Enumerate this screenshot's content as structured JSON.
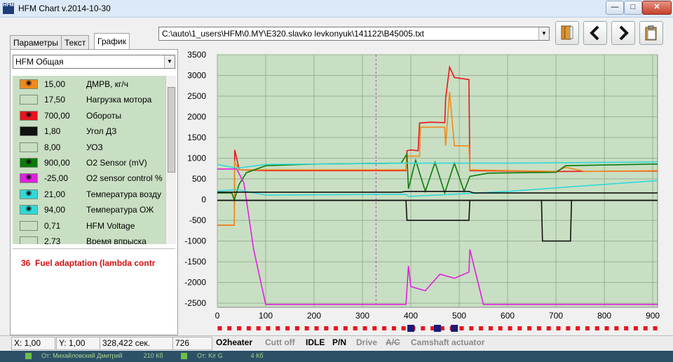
{
  "window": {
    "title": "HFM Chart  v.2014-10-30",
    "icon": "HFM"
  },
  "window_controls": {
    "minimize": "—",
    "maximize": "□",
    "close": "✕"
  },
  "tabs": [
    {
      "label": "Параметры"
    },
    {
      "label": "Текст"
    },
    {
      "label": "График"
    }
  ],
  "preset": {
    "value": "HFM Общая"
  },
  "file": {
    "path": "C:\\auto\\1_users\\HFM\\0.MY\\E320.slavko levkonyuk\\141122\\B45005.txt"
  },
  "toolbar_icons": [
    "book-icon",
    "arrow-left-icon",
    "arrow-right-icon",
    "clipboard-icon"
  ],
  "sensors": [
    {
      "value": "15,00",
      "name": "ДМРВ, кг/ч",
      "color": "#f08a1c",
      "visible": true
    },
    {
      "value": "17,50",
      "name": "Нагрузка мотора",
      "color": "#c9dfc3",
      "visible": false
    },
    {
      "value": "700,00",
      "name": "Обороты",
      "color": "#e8141c",
      "visible": true
    },
    {
      "value": "1,80",
      "name": "Угол ДЗ",
      "color": "#111111",
      "visible": true
    },
    {
      "value": "8,00",
      "name": "УОЗ",
      "color": "#c9dfc3",
      "visible": false
    },
    {
      "value": "900,00",
      "name": "O2 Sensor (mV)",
      "color": "#0a7a0a",
      "visible": true
    },
    {
      "value": "-25,00",
      "name": "O2 sensor control %",
      "color": "#e020e0",
      "visible": true
    },
    {
      "value": "21,00",
      "name": "Температура возду",
      "color": "#30d8d8",
      "visible": true
    },
    {
      "value": "94,00",
      "name": "Температура ОЖ",
      "color": "#30d8d8",
      "visible": true
    },
    {
      "value": "0,71",
      "name": "HFM Voltage",
      "color": "#c9dfc3",
      "visible": false
    },
    {
      "value": "2,73",
      "name": "Время впрыска",
      "color": "#c9dfc3",
      "visible": false
    }
  ],
  "fault": {
    "code": "36",
    "text": "Fuel adaptation (lambda contr"
  },
  "status": {
    "x": "X: 1,00",
    "y": "Y: 1,00",
    "time": "328,422 сек.",
    "index": "726"
  },
  "flags": [
    {
      "label": "O2heater",
      "active": true
    },
    {
      "label": "Cutt off",
      "active": false
    },
    {
      "label": "IDLE",
      "active": true
    },
    {
      "label": "P/N",
      "active": true
    },
    {
      "label": "Drive",
      "active": false
    },
    {
      "label": "A/C",
      "active": false,
      "struck": true
    },
    {
      "label": "Camshaft actuator",
      "active": false
    }
  ],
  "taskbar": [
    {
      "label": "От: Михайловский Дмитрий",
      "size": "210 Кб"
    },
    {
      "label": "От: Kir G",
      "size": "4 Кб"
    }
  ],
  "chart_data": {
    "type": "line",
    "xlim": [
      0,
      910
    ],
    "ylim": [
      -2600,
      3500
    ],
    "xticks": [
      0,
      100,
      200,
      300,
      400,
      500,
      600,
      700,
      800,
      900
    ],
    "yticks": [
      3500,
      3000,
      2500,
      2000,
      1500,
      1000,
      500,
      0,
      -500,
      -1000,
      -1500,
      -2000,
      -2500
    ],
    "cursor_x": 328,
    "grid": true,
    "series": [
      {
        "color": "#e8141c",
        "points": [
          [
            0,
            -620
          ],
          [
            35,
            -620
          ],
          [
            36,
            1200
          ],
          [
            40,
            1000
          ],
          [
            45,
            720
          ],
          [
            100,
            700
          ],
          [
            380,
            700
          ],
          [
            390,
            700
          ],
          [
            392,
            1180
          ],
          [
            400,
            1200
          ],
          [
            415,
            1180
          ],
          [
            418,
            1850
          ],
          [
            440,
            1870
          ],
          [
            470,
            1860
          ],
          [
            472,
            2450
          ],
          [
            480,
            3200
          ],
          [
            490,
            2950
          ],
          [
            520,
            2900
          ],
          [
            522,
            700
          ],
          [
            600,
            690
          ],
          [
            700,
            680
          ],
          [
            910,
            690
          ]
        ]
      },
      {
        "color": "#f08a1c",
        "points": [
          [
            0,
            -620
          ],
          [
            35,
            -620
          ],
          [
            36,
            900
          ],
          [
            45,
            720
          ],
          [
            100,
            720
          ],
          [
            390,
            720
          ],
          [
            392,
            1050
          ],
          [
            418,
            1050
          ],
          [
            420,
            1750
          ],
          [
            470,
            1750
          ],
          [
            472,
            1300
          ],
          [
            480,
            2600
          ],
          [
            490,
            1300
          ],
          [
            520,
            1300
          ],
          [
            522,
            720
          ],
          [
            600,
            700
          ],
          [
            700,
            680
          ],
          [
            720,
            780
          ],
          [
            760,
            680
          ],
          [
            910,
            700
          ]
        ]
      },
      {
        "color": "#0a7a0a",
        "points": [
          [
            0,
            160
          ],
          [
            30,
            160
          ],
          [
            35,
            -10
          ],
          [
            40,
            180
          ],
          [
            45,
            370
          ],
          [
            60,
            650
          ],
          [
            100,
            820
          ],
          [
            200,
            860
          ],
          [
            380,
            880
          ],
          [
            392,
            1100
          ],
          [
            395,
            260
          ],
          [
            410,
            950
          ],
          [
            430,
            200
          ],
          [
            450,
            900
          ],
          [
            470,
            160
          ],
          [
            490,
            880
          ],
          [
            510,
            200
          ],
          [
            522,
            560
          ],
          [
            560,
            640
          ],
          [
            700,
            660
          ],
          [
            720,
            820
          ],
          [
            910,
            860
          ]
        ]
      },
      {
        "color": "#e020e0",
        "points": [
          [
            0,
            740
          ],
          [
            40,
            740
          ],
          [
            55,
            400
          ],
          [
            75,
            -1200
          ],
          [
            100,
            -2530
          ],
          [
            390,
            -2530
          ],
          [
            395,
            -1600
          ],
          [
            400,
            -2100
          ],
          [
            430,
            -2200
          ],
          [
            460,
            -1800
          ],
          [
            490,
            -1900
          ],
          [
            520,
            -1750
          ],
          [
            522,
            -1200
          ],
          [
            550,
            -2530
          ],
          [
            910,
            -2530
          ]
        ]
      },
      {
        "color": "#30d8d8",
        "points": [
          [
            0,
            850
          ],
          [
            40,
            760
          ],
          [
            100,
            850
          ],
          [
            400,
            880
          ],
          [
            600,
            880
          ],
          [
            910,
            910
          ]
        ]
      },
      {
        "color": "#30d8d8",
        "points": [
          [
            0,
            210
          ],
          [
            40,
            240
          ],
          [
            100,
            110
          ],
          [
            390,
            130
          ],
          [
            395,
            75
          ],
          [
            520,
            150
          ],
          [
            600,
            200
          ],
          [
            910,
            460
          ]
        ]
      },
      {
        "color": "#111111",
        "points": [
          [
            0,
            180
          ],
          [
            380,
            180
          ],
          [
            390,
            200
          ],
          [
            520,
            200
          ],
          [
            530,
            160
          ],
          [
            910,
            160
          ]
        ]
      },
      {
        "color": "#111111",
        "points": [
          [
            0,
            -20
          ],
          [
            910,
            -20
          ]
        ]
      },
      {
        "color": "#111111",
        "points": [
          [
            390,
            -20
          ],
          [
            392,
            -500
          ],
          [
            520,
            -500
          ],
          [
            522,
            -20
          ]
        ]
      },
      {
        "color": "#111111",
        "points": [
          [
            670,
            -20
          ],
          [
            672,
            -1000
          ],
          [
            730,
            -1000
          ],
          [
            732,
            -20
          ]
        ]
      }
    ],
    "markers": {
      "red_x": [
        0,
        60,
        100,
        200,
        300,
        380,
        430,
        470,
        560,
        600,
        700,
        800,
        900
      ],
      "blue_x": [
        400,
        455,
        490
      ]
    }
  }
}
